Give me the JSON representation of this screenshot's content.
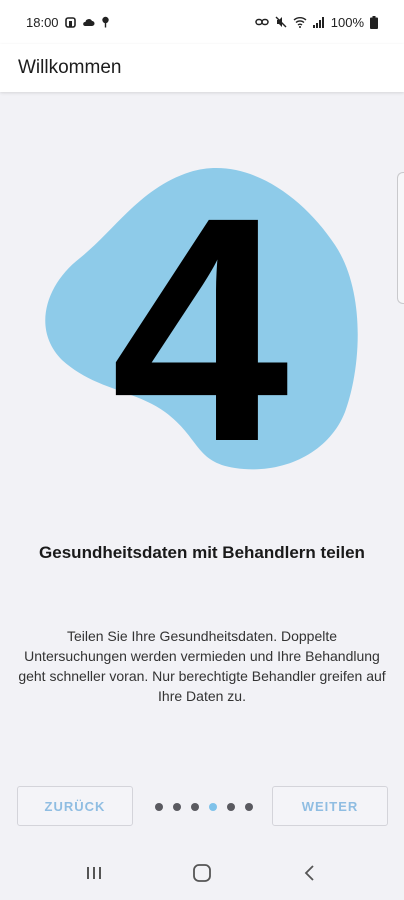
{
  "status_bar": {
    "time": "18:00",
    "battery": "100%"
  },
  "app_bar": {
    "title": "Willkommen"
  },
  "onboarding": {
    "step_number": "4",
    "headline": "Gesundheitsdaten mit Behandlern teilen",
    "body": "Teilen Sie Ihre Gesundheitsdaten. Doppelte Untersuchungen werden vermieden und Ihre Behandlung geht schneller voran. Nur berechtigte Behandler greifen auf Ihre Daten zu.",
    "blob_color": "#8ecbe9",
    "page_count": 6,
    "current_page": 4
  },
  "navigation": {
    "back_label": "ZURÜCK",
    "next_label": "WEITER"
  },
  "colors": {
    "accent": "#8fbde2",
    "dot_active": "#7fc2ea",
    "dot_inactive": "#5a5a60"
  }
}
